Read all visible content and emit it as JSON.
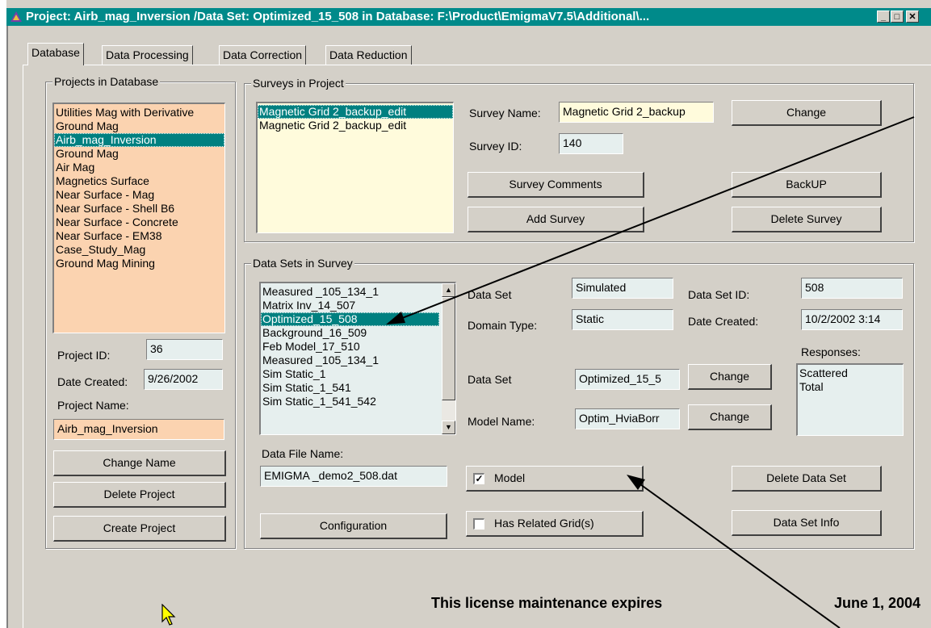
{
  "window": {
    "title": "Project: Airb_mag_Inversion  /Data Set:  Optimized_15_508    in Database: F:\\Product\\EmigmaV7.5\\Additional\\..."
  },
  "tabs": [
    "Database",
    "Data Processing",
    "Data Correction",
    "Data Reduction"
  ],
  "projects": {
    "group_label": "Projects in Database",
    "items": [
      "Utilities Mag with Derivative",
      "Ground Mag",
      "Airb_mag_Inversion",
      "Ground Mag",
      "Air Mag",
      "Magnetics Surface",
      "Near Surface -  Mag",
      "Near Surface - Shell B6",
      "Near Surface - Concrete",
      "Near Surface -  EM38",
      "Case_Study_Mag",
      "Ground Mag Mining"
    ],
    "selected_index": 2,
    "project_id_label": "Project ID:",
    "project_id": "36",
    "date_created_label": "Date Created:",
    "date_created": "9/26/2002",
    "project_name_label": "Project Name:",
    "project_name": "Airb_mag_Inversion",
    "change_name_button": "Change Name",
    "delete_project_button": "Delete Project",
    "create_project_button": "Create Project"
  },
  "surveys": {
    "group_label": "Surveys in Project",
    "items": [
      "Magnetic Grid 2_backup_edit",
      "Magnetic Grid 2_backup_edit"
    ],
    "selected_index": 0,
    "survey_name_label": "Survey Name:",
    "survey_name": "Magnetic Grid 2_backup",
    "survey_id_label": "Survey ID:",
    "survey_id": "140",
    "change_button": "Change",
    "survey_comments_button": "Survey Comments",
    "backup_button": "BackUP",
    "add_survey_button": "Add Survey",
    "delete_survey_button": "Delete Survey"
  },
  "datasets": {
    "group_label": "Data Sets in Survey",
    "items": [
      "Measured  _105_134_1",
      "Matrix Inv_14_507",
      "Optimized_15_508",
      "Background_16_509",
      "Feb Model_17_510",
      "Measured  _105_134_1",
      "Sim Static_1",
      "Sim Static_1_541",
      "Sim Static_1_541_542"
    ],
    "selected_index": 2,
    "data_set_label": "Data Set",
    "data_set_type": "Simulated",
    "data_set_id_label": "Data Set ID:",
    "data_set_id": "508",
    "domain_type_label": "Domain Type:",
    "domain_type": "Static",
    "date_created_label": "Date Created:",
    "date_created": "10/2/2002 3:14",
    "responses_label": "Responses:",
    "responses": [
      "Scattered",
      "Total"
    ],
    "data_set_name_label": "Data Set",
    "data_set_name": "Optimized_15_5",
    "change_button": "Change",
    "model_name_label": "Model Name:",
    "model_name": "Optim_HviaBorr",
    "model_change_button": "Change",
    "data_file_name_label": "Data File Name:",
    "data_file_name": "EMIGMA _demo2_508.dat",
    "model_checkbox_label": "Model",
    "model_checked": true,
    "related_grid_label": "Has Related Grid(s)",
    "related_grid_checked": false,
    "configuration_button": "Configuration",
    "delete_data_set_button": "Delete Data Set",
    "data_set_info_button": "Data Set Info"
  },
  "footer": {
    "license_text": "This license maintenance expires",
    "license_date": "June 1, 2004"
  }
}
